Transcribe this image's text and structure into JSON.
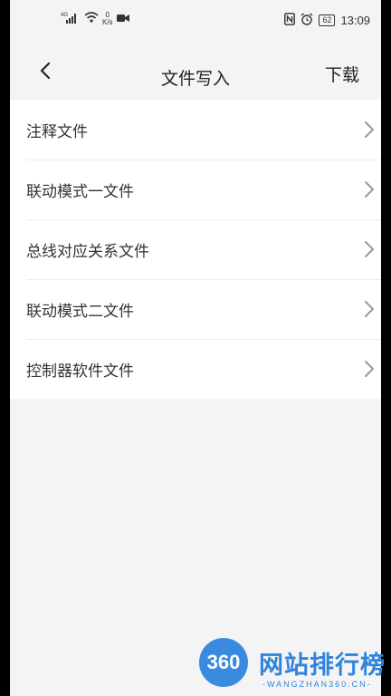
{
  "status_bar": {
    "network_speed_value": "0",
    "network_speed_unit": "K/s",
    "signal_type": "4G",
    "battery": "62",
    "time": "13:09"
  },
  "nav": {
    "title": "文件写入",
    "action_label": "下载"
  },
  "list": {
    "items": [
      {
        "label": "注释文件"
      },
      {
        "label": "联动模式一文件"
      },
      {
        "label": "总线对应关系文件"
      },
      {
        "label": "联动模式二文件"
      },
      {
        "label": "控制器软件文件"
      }
    ]
  },
  "watermark": {
    "logo_text": "360",
    "title": "网站排行榜",
    "subtitle": "-WANGZHAN360.CN-"
  },
  "colors": {
    "background": "#f4f4f4",
    "list_background": "#ffffff",
    "text": "#333333",
    "chevron": "#9a9a9a",
    "watermark_blue": "#2f84de"
  }
}
